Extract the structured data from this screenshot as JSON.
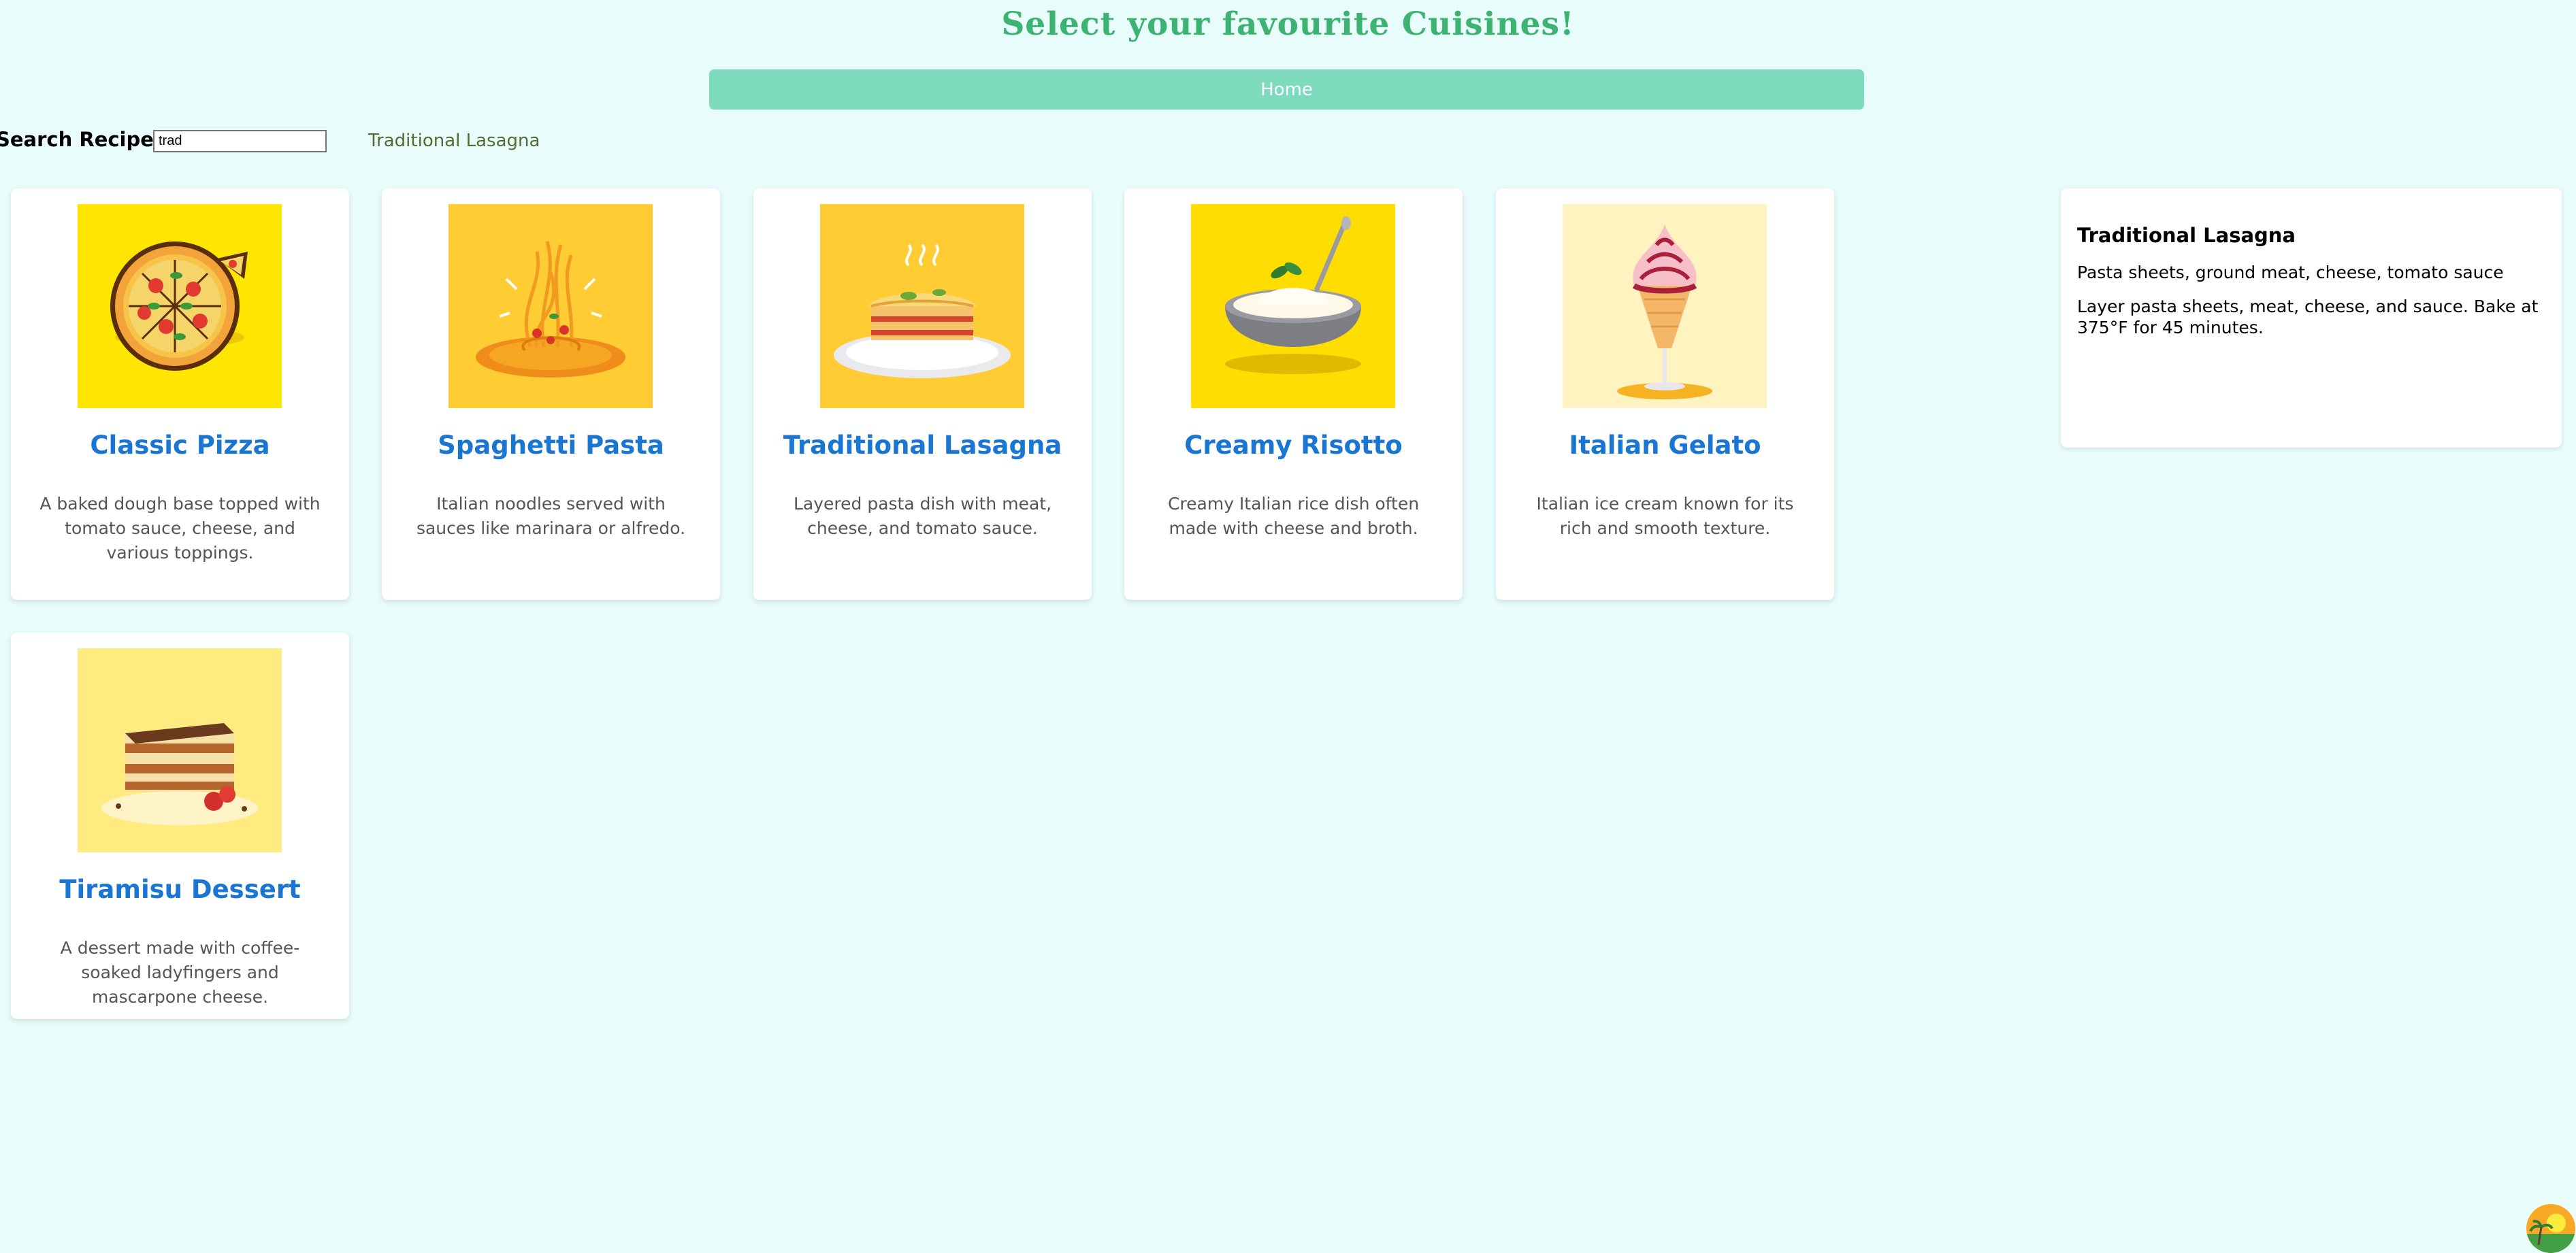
{
  "header": {
    "title": "Select your favourite Cuisines!"
  },
  "nav": {
    "home_label": "Home"
  },
  "search": {
    "label": "Search Recipes",
    "value": "trad",
    "suggestion": "Traditional Lasagna"
  },
  "cards": [
    {
      "title": "Classic Pizza",
      "desc": "A baked dough base topped with tomato sauce, cheese, and various toppings.",
      "icon": "pizza-icon",
      "bg": "#ffe600"
    },
    {
      "title": "Spaghetti Pasta",
      "desc": "Italian noodles served with sauces like marinara or alfredo.",
      "icon": "spaghetti-icon",
      "bg": "#ffcc33"
    },
    {
      "title": "Traditional Lasagna",
      "desc": "Layered pasta dish with meat, cheese, and tomato sauce.",
      "icon": "lasagna-icon",
      "bg": "#ffcc33"
    },
    {
      "title": "Creamy Risotto",
      "desc": "Creamy Italian rice dish often made with cheese and broth.",
      "icon": "risotto-icon",
      "bg": "#ffdd00"
    },
    {
      "title": "Italian Gelato",
      "desc": "Italian ice cream known for its rich and smooth texture.",
      "icon": "gelato-icon",
      "bg": "#fff3c0"
    },
    {
      "title": "Tiramisu Dessert",
      "desc": "A dessert made with coffee-soaked ladyfingers and mascarpone cheese.",
      "icon": "tiramisu-icon",
      "bg": "#ffeb80"
    }
  ],
  "detail": {
    "title": "Traditional Lasagna",
    "ingredients": "Pasta sheets, ground meat, cheese, tomato sauce",
    "instructions": "Layer pasta sheets, meat, cheese, and sauce. Bake at 375°F for 45 minutes."
  },
  "colors": {
    "page_bg": "#e8fdfb",
    "title": "#3cb371",
    "nav_bar": "#7fdbbd",
    "card_title": "#1976d2",
    "suggestion": "#556b2f"
  }
}
